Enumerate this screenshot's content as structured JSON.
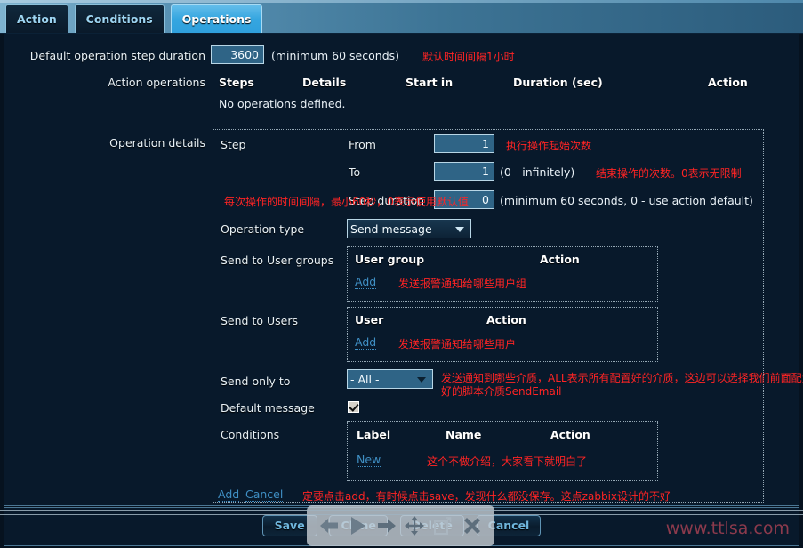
{
  "tabs": [
    {
      "label": "Action",
      "active": false
    },
    {
      "label": "Conditions",
      "active": false
    },
    {
      "label": "Operations",
      "active": true
    }
  ],
  "form": {
    "default_step_duration_label": "Default operation step duration",
    "default_step_duration_value": "3600",
    "default_step_duration_hint": "(minimum 60 seconds)",
    "default_step_duration_note_cn": "默认时间间隔1小时",
    "action_operations_label": "Action operations",
    "action_operations_columns": [
      "Steps",
      "Details",
      "Start in",
      "Duration (sec)",
      "Action"
    ],
    "action_operations_empty": "No operations defined.",
    "operation_details_label": "Operation details",
    "step_label": "Step",
    "step_from_label": "From",
    "step_from_value": "1",
    "step_from_note_cn": "执行操作起始次数",
    "step_to_label": "To",
    "step_to_value": "1",
    "step_to_hint": "(0 - infinitely)",
    "step_to_note_cn": "结束操作的次数。0表示无限制",
    "step_duration_label": "Step duration",
    "step_duration_value": "0",
    "step_duration_hint": "(minimum 60 seconds, 0 - use action default)",
    "step_duration_note_cn": "每次操作的时间间隔，最小60秒，0表示使用默认值",
    "operation_type_label": "Operation type",
    "operation_type_value": "Send message",
    "operation_type_options": [
      "Send message"
    ],
    "send_to_user_groups_label": "Send to User groups",
    "user_group_columns": [
      "User group",
      "Action"
    ],
    "user_group_add": "Add",
    "user_group_note_cn": "发送报警通知给哪些用户组",
    "send_to_users_label": "Send to Users",
    "user_columns": [
      "User",
      "Action"
    ],
    "user_add": "Add",
    "user_note_cn": "发送报警通知给哪些用户",
    "send_only_to_label": "Send only to",
    "send_only_to_value": "- All -",
    "send_only_to_options": [
      "- All -"
    ],
    "send_only_to_note_cn_line1": "发送通知到哪些介质，ALL表示所有配置好的介质，这边可以选择我们前面配置",
    "send_only_to_note_cn_line2": "好的脚本介质SendEmail",
    "default_message_label": "Default message",
    "default_message_checked": true,
    "conditions_label": "Conditions",
    "conditions_columns": [
      "Label",
      "Name",
      "Action"
    ],
    "conditions_new": "New",
    "conditions_note_cn": "这个不做介绍，大家看下就明白了",
    "add_link": "Add",
    "cancel_link": "Cancel",
    "add_cancel_note_cn": "一定要点击add，有时候点击save，发现什么都没保存。这点zabbix设计的不好"
  },
  "footer": {
    "buttons": [
      "Save",
      "Clone",
      "Delete",
      "Cancel"
    ],
    "watermark": "www.ttlsa.com"
  },
  "floating_toolbar": {
    "icons": [
      "arrow-left-icon",
      "play-icon",
      "arrow-right-icon",
      "move-icon",
      "resize-icon",
      "close-icon"
    ]
  },
  "colors": {
    "accent": "#35a6e0",
    "note_red": "#ff2424",
    "panel_bg": "#08192b",
    "input_bg": "#2f6486",
    "link": "#3f8fc4"
  }
}
